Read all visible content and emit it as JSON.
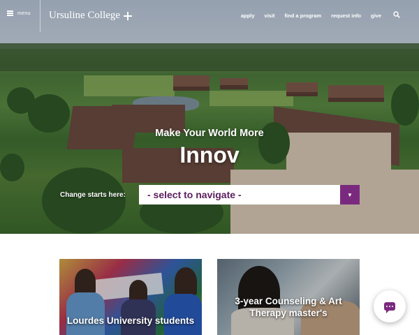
{
  "header": {
    "menu_label": "menu",
    "logo_text": "Ursuline College",
    "nav": [
      "apply",
      "visit",
      "find a program",
      "request info",
      "give"
    ]
  },
  "hero": {
    "headline": "Make Your World More",
    "rotating_word": "Innov",
    "navigate_label": "Change starts here:",
    "select_value": "- select to navigate -"
  },
  "cards": [
    {
      "title": "Lourdes University students"
    },
    {
      "title": "3-year Counseling & Art Therapy master's"
    }
  ],
  "icons": {
    "menu": "hamburger-icon",
    "logo": "cross-icon",
    "search": "search-icon",
    "select": "triangle-down-icon",
    "chat": "chat-icon"
  },
  "colors": {
    "accent": "#7a2a7e",
    "select_text": "#5a1d5e"
  }
}
